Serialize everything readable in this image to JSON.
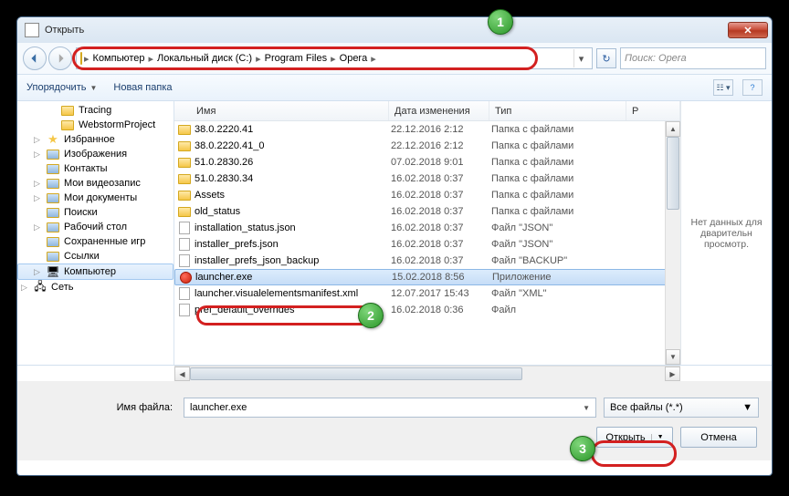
{
  "title": "Открыть",
  "breadcrumb": [
    "Компьютер",
    "Локальный диск (C:)",
    "Program Files",
    "Opera"
  ],
  "search_placeholder": "Поиск: Opera",
  "toolbar": {
    "organize": "Упорядочить",
    "newfolder": "Новая папка"
  },
  "tree": [
    {
      "label": "Tracing",
      "indent": 2,
      "icon": "folder"
    },
    {
      "label": "WebstormProject",
      "indent": 2,
      "icon": "folder"
    },
    {
      "label": "Избранное",
      "indent": 1,
      "icon": "star",
      "tw": "▷"
    },
    {
      "label": "Изображения",
      "indent": 1,
      "icon": "pic",
      "tw": "▷"
    },
    {
      "label": "Контакты",
      "indent": 1,
      "icon": "contact"
    },
    {
      "label": "Мои видеозапис",
      "indent": 1,
      "icon": "video",
      "tw": "▷"
    },
    {
      "label": "Мои документы",
      "indent": 1,
      "icon": "doc",
      "tw": "▷"
    },
    {
      "label": "Поиски",
      "indent": 1,
      "icon": "search"
    },
    {
      "label": "Рабочий стол",
      "indent": 1,
      "icon": "desk",
      "tw": "▷"
    },
    {
      "label": "Сохраненные игр",
      "indent": 1,
      "icon": "game"
    },
    {
      "label": "Ссылки",
      "indent": 1,
      "icon": "link"
    },
    {
      "label": "Компьютер",
      "indent": 0,
      "icon": "pc",
      "tw": "▷",
      "sel": true
    },
    {
      "label": "Сеть",
      "indent": 0,
      "icon": "net",
      "tw": "▷"
    }
  ],
  "columns": {
    "name": "Имя",
    "date": "Дата изменения",
    "type": "Тип",
    "size": "Р"
  },
  "files": [
    {
      "name": "38.0.2220.41",
      "date": "22.12.2016 2:12",
      "type": "Папка с файлами",
      "icon": "folder"
    },
    {
      "name": "38.0.2220.41_0",
      "date": "22.12.2016 2:12",
      "type": "Папка с файлами",
      "icon": "folder"
    },
    {
      "name": "51.0.2830.26",
      "date": "07.02.2018 9:01",
      "type": "Папка с файлами",
      "icon": "folder"
    },
    {
      "name": "51.0.2830.34",
      "date": "16.02.2018 0:37",
      "type": "Папка с файлами",
      "icon": "folder"
    },
    {
      "name": "Assets",
      "date": "16.02.2018 0:37",
      "type": "Папка с файлами",
      "icon": "folder"
    },
    {
      "name": "old_status",
      "date": "16.02.2018 0:37",
      "type": "Папка с файлами",
      "icon": "folder"
    },
    {
      "name": "installation_status.json",
      "date": "16.02.2018 0:37",
      "type": "Файл \"JSON\"",
      "icon": "file"
    },
    {
      "name": "installer_prefs.json",
      "date": "16.02.2018 0:37",
      "type": "Файл \"JSON\"",
      "icon": "file"
    },
    {
      "name": "installer_prefs_json_backup",
      "date": "16.02.2018 0:37",
      "type": "Файл \"BACKUP\"",
      "icon": "file"
    },
    {
      "name": "launcher.exe",
      "date": "15.02.2018 8:56",
      "type": "Приложение",
      "icon": "opera",
      "sel": true
    },
    {
      "name": "launcher.visualelementsmanifest.xml",
      "date": "12.07.2017 15:43",
      "type": "Файл \"XML\"",
      "icon": "file"
    },
    {
      "name": "pref_default_overrides",
      "date": "16.02.2018 0:36",
      "type": "Файл",
      "icon": "file"
    }
  ],
  "preview_text": "Нет данных для дварительн просмотр.",
  "filename_label": "Имя файла:",
  "filename_value": "launcher.exe",
  "filter_label": "Все файлы (*.*)",
  "buttons": {
    "open": "Открыть",
    "cancel": "Отмена"
  },
  "badges": {
    "1": "1",
    "2": "2",
    "3": "3"
  }
}
